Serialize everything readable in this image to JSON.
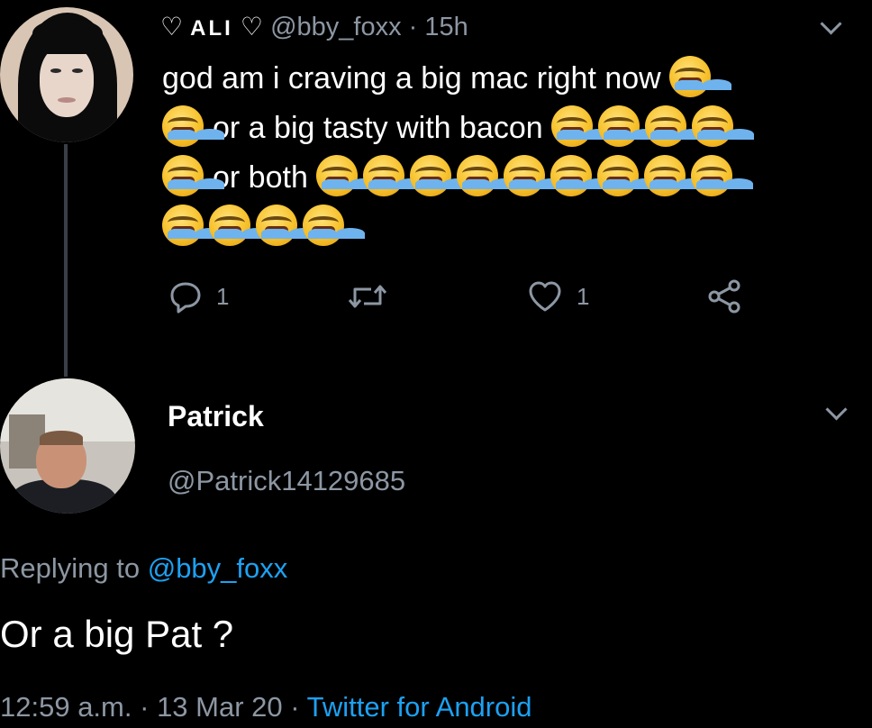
{
  "original_tweet": {
    "display_name": "ALI",
    "name_decoration_left": "♡",
    "name_decoration_right": "♡",
    "handle": "@bby_foxx",
    "separator": "·",
    "time_ago": "15h",
    "text_line1": "god am i craving a big mac right now",
    "text_line2": "or a big tasty with bacon",
    "text_line3": "or both",
    "emoji": "loudly-crying-face",
    "emoji_counts": {
      "line1_end": 1,
      "line2_start": 1,
      "line2_end": 4,
      "line3_start": 1,
      "line3_end": 9,
      "line4": 4
    },
    "actions": {
      "reply_count": "1",
      "retweet_count": "",
      "like_count": "1"
    }
  },
  "reply": {
    "display_name": "Patrick",
    "handle": "@Patrick14129685",
    "replying_prefix": "Replying to",
    "replying_handle": "@bby_foxx",
    "text": "Or a big Pat ?",
    "time": "12:59 a.m.",
    "dot1": "·",
    "date": "13 Mar 20",
    "dot2": "·",
    "source": "Twitter for Android"
  },
  "colors": {
    "background": "#000000",
    "text_primary": "#ffffff",
    "text_secondary": "#8d97a3",
    "link": "#1da1f2",
    "thread_line": "#3a3f47"
  }
}
